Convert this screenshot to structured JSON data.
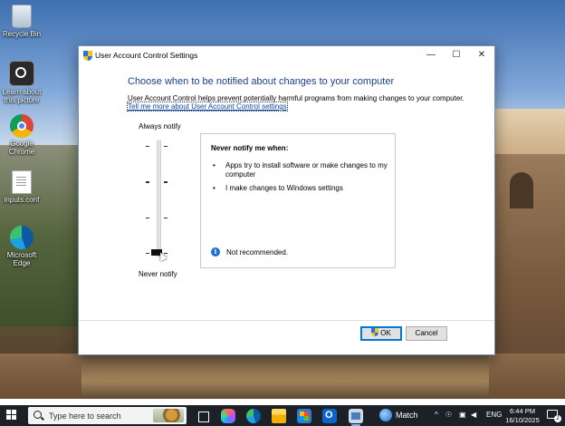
{
  "desktop": {
    "icons": [
      {
        "label": "Recycle Bin",
        "icon": "recycle-bin-icon"
      },
      {
        "label": "Learn about this picture",
        "icon": "learn-picture-icon"
      },
      {
        "label": "Google Chrome",
        "icon": "chrome-icon"
      },
      {
        "label": "inputs.conf",
        "icon": "file-icon"
      },
      {
        "label": "Microsoft Edge",
        "icon": "edge-icon"
      }
    ]
  },
  "dialog": {
    "title": "User Account Control Settings",
    "heading": "Choose when to be notified about changes to your computer",
    "description": "User Account Control helps prevent potentially harmful programs from making changes to your computer.",
    "link": "Tell me more about User Account Control settings",
    "slider": {
      "top_label": "Always notify",
      "bottom_label": "Never notify",
      "levels": 4,
      "selected_level": 0
    },
    "info": {
      "title": "Never notify me when:",
      "bullets": [
        "Apps try to install software or make changes to my computer",
        "I make changes to Windows settings"
      ],
      "note": "Not recommended."
    },
    "buttons": {
      "ok": "OK",
      "cancel": "Cancel"
    },
    "window_controls": {
      "minimize": "—",
      "maximize": "☐",
      "close": "✕"
    }
  },
  "taskbar": {
    "search_placeholder": "Type here to search",
    "weather_label": "Match",
    "language": "ENG",
    "time": "6:44 PM",
    "date": "16/10/2025",
    "notification_count": "2",
    "accent": "#0078d7"
  }
}
